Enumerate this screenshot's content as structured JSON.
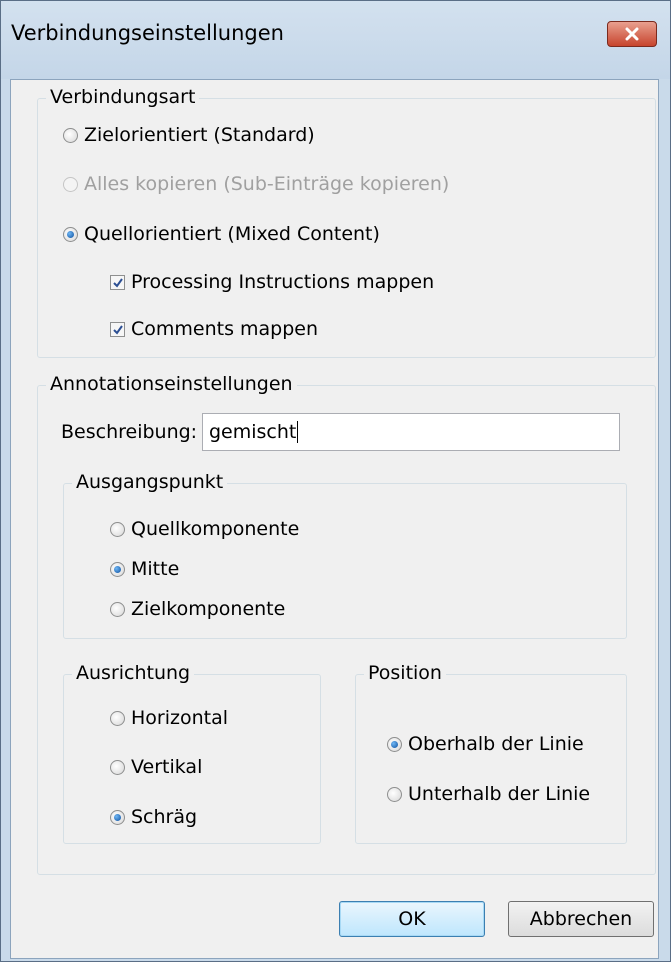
{
  "window": {
    "title": "Verbindungseinstellungen"
  },
  "connection_type": {
    "legend": "Verbindungsart",
    "options": [
      {
        "label": "Zielorientiert (Standard)",
        "checked": false,
        "enabled": true
      },
      {
        "label": "Alles kopieren (Sub-Einträge kopieren)",
        "checked": false,
        "enabled": false
      },
      {
        "label": "Quellorientiert (Mixed Content)",
        "checked": true,
        "enabled": true
      }
    ],
    "checkboxes": [
      {
        "label": "Processing Instructions mappen",
        "checked": true
      },
      {
        "label": "Comments mappen",
        "checked": true
      }
    ]
  },
  "annotation": {
    "legend": "Annotationseinstellungen",
    "description_label": "Beschreibung:",
    "description_value": "gemischt",
    "start_point": {
      "legend": "Ausgangspunkt",
      "options": [
        {
          "label": "Quellkomponente",
          "checked": false
        },
        {
          "label": "Mitte",
          "checked": true
        },
        {
          "label": "Zielkomponente",
          "checked": false
        }
      ]
    },
    "orientation": {
      "legend": "Ausrichtung",
      "options": [
        {
          "label": "Horizontal",
          "checked": false
        },
        {
          "label": "Vertikal",
          "checked": false
        },
        {
          "label": "Schräg",
          "checked": true
        }
      ]
    },
    "position": {
      "legend": "Position",
      "options": [
        {
          "label": "Oberhalb der Linie",
          "checked": true
        },
        {
          "label": "Unterhalb der Linie",
          "checked": false
        }
      ]
    }
  },
  "buttons": {
    "ok": "OK",
    "cancel": "Abbrechen"
  },
  "icons": {
    "close": "close-icon",
    "check": "checkmark-icon"
  },
  "colors": {
    "titlebar": "#c9daea",
    "close_button": "#c7442d",
    "radio_dot": "#0d4f9e",
    "checkmark": "#2c4f93",
    "ok_border": "#3c7fb1"
  }
}
